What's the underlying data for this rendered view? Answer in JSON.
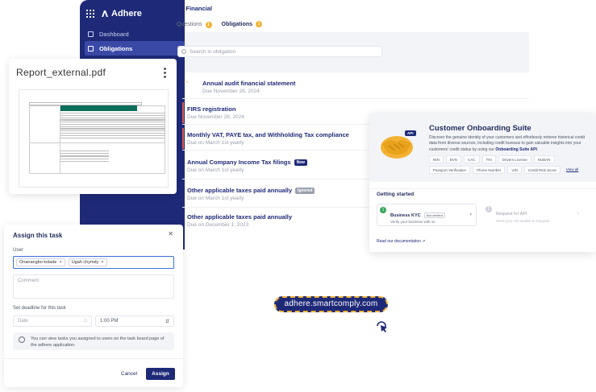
{
  "brand": {
    "name": "Adhere"
  },
  "sidebar": {
    "items": [
      {
        "label": "Dashboard"
      },
      {
        "label": "Obligations"
      }
    ]
  },
  "header": {
    "back_label": "Financial"
  },
  "tabs": [
    {
      "label": "Questions",
      "count": "1"
    },
    {
      "label": "Obligations",
      "count": "1"
    }
  ],
  "search": {
    "placeholder": "Search in obligation"
  },
  "obligations": [
    {
      "title": "Annual audit financial statement",
      "due": "Due November 28, 2024"
    },
    {
      "title": "FIRS registration",
      "due": "Due November 28, 2024"
    },
    {
      "title": "Monthly VAT, PAYE tax, and Withholding Tax compliance",
      "due": "Due on March 1st yearly"
    },
    {
      "title": "Annual Company Income Tax filings",
      "due": "Due on March 1st yearly",
      "badge": "New"
    },
    {
      "title": "Other applicable taxes paid annually",
      "due": "Due on March 1st yearly",
      "badge": "Ignored"
    },
    {
      "title": "Other applicable taxes paid annually",
      "due": "Due on December 1, 2023"
    }
  ],
  "colors": {
    "navy": "#1e2a78",
    "gold": "#f2b233",
    "red": "#e05a4f",
    "green": "#0b6e5b"
  },
  "pdf": {
    "filename": "Report_external.pdf"
  },
  "assign": {
    "title": "Assign this task",
    "user_label": "User",
    "users": [
      "Onanangbo kolade",
      "Ugah chymdy"
    ],
    "comment_placeholder": "Comment",
    "deadline_label": "Set deadline for this task",
    "date_placeholder": "Date",
    "time_value": "1:00 PM",
    "info_text": "You can view tasks you assigned to users on the task board page of the adhere application.",
    "cancel_label": "Cancel",
    "assign_label": "Assign"
  },
  "onboarding": {
    "title": "Customer Onboarding Suite",
    "api_badge": "API",
    "description": "Discover the genuine identity of your customers and effortlessly retrieve historical credit data from diverse sources, including credit bureaus to gain valuable insights into your customers' credit status by using our",
    "description_link": "Onboarding Suite API",
    "tags": [
      "NIN",
      "BVN",
      "CAC",
      "TIN",
      "Drivers License",
      "NUBAN",
      "Passport Verification",
      "Phone Number",
      "VIN",
      "Credit Risk Score"
    ],
    "view_all": "View all",
    "getting_started": "Getting started",
    "steps": [
      {
        "num": "1",
        "title": "Business KYC",
        "status": "Not verified",
        "desc": "Verify your business with us"
      },
      {
        "num": "2",
        "title": "Request for API",
        "desc": "Send your API waitlist & integrate"
      }
    ],
    "read_docs": "Read our documentation"
  },
  "url": "adhere.smartcomply.com"
}
